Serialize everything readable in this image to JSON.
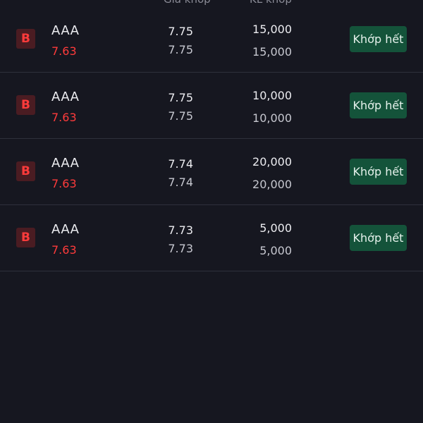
{
  "header": {
    "price_label": "Giá khớp",
    "volume_label": "KL khớp"
  },
  "orders": [
    {
      "side": "B",
      "symbol": "AAA",
      "ref_price": "7.63",
      "match_price": "7.75",
      "order_price": "7.75",
      "match_volume": "15,000",
      "order_volume": "15,000",
      "status": "Khớp hết"
    },
    {
      "side": "B",
      "symbol": "AAA",
      "ref_price": "7.63",
      "match_price": "7.75",
      "order_price": "7.75",
      "match_volume": "10,000",
      "order_volume": "10,000",
      "status": "Khớp hết"
    },
    {
      "side": "B",
      "symbol": "AAA",
      "ref_price": "7.63",
      "match_price": "7.74",
      "order_price": "7.74",
      "match_volume": "20,000",
      "order_volume": "20,000",
      "status": "Khớp hết"
    },
    {
      "side": "B",
      "symbol": "AAA",
      "ref_price": "7.63",
      "match_price": "7.73",
      "order_price": "7.73",
      "match_volume": "5,000",
      "order_volume": "5,000",
      "status": "Khớp hết"
    }
  ],
  "colors": {
    "background": "#161720",
    "buy": "#ff3b3b",
    "buy_badge_bg": "#4a1c22",
    "status_bg": "#14533a",
    "divider": "#2e303b"
  }
}
